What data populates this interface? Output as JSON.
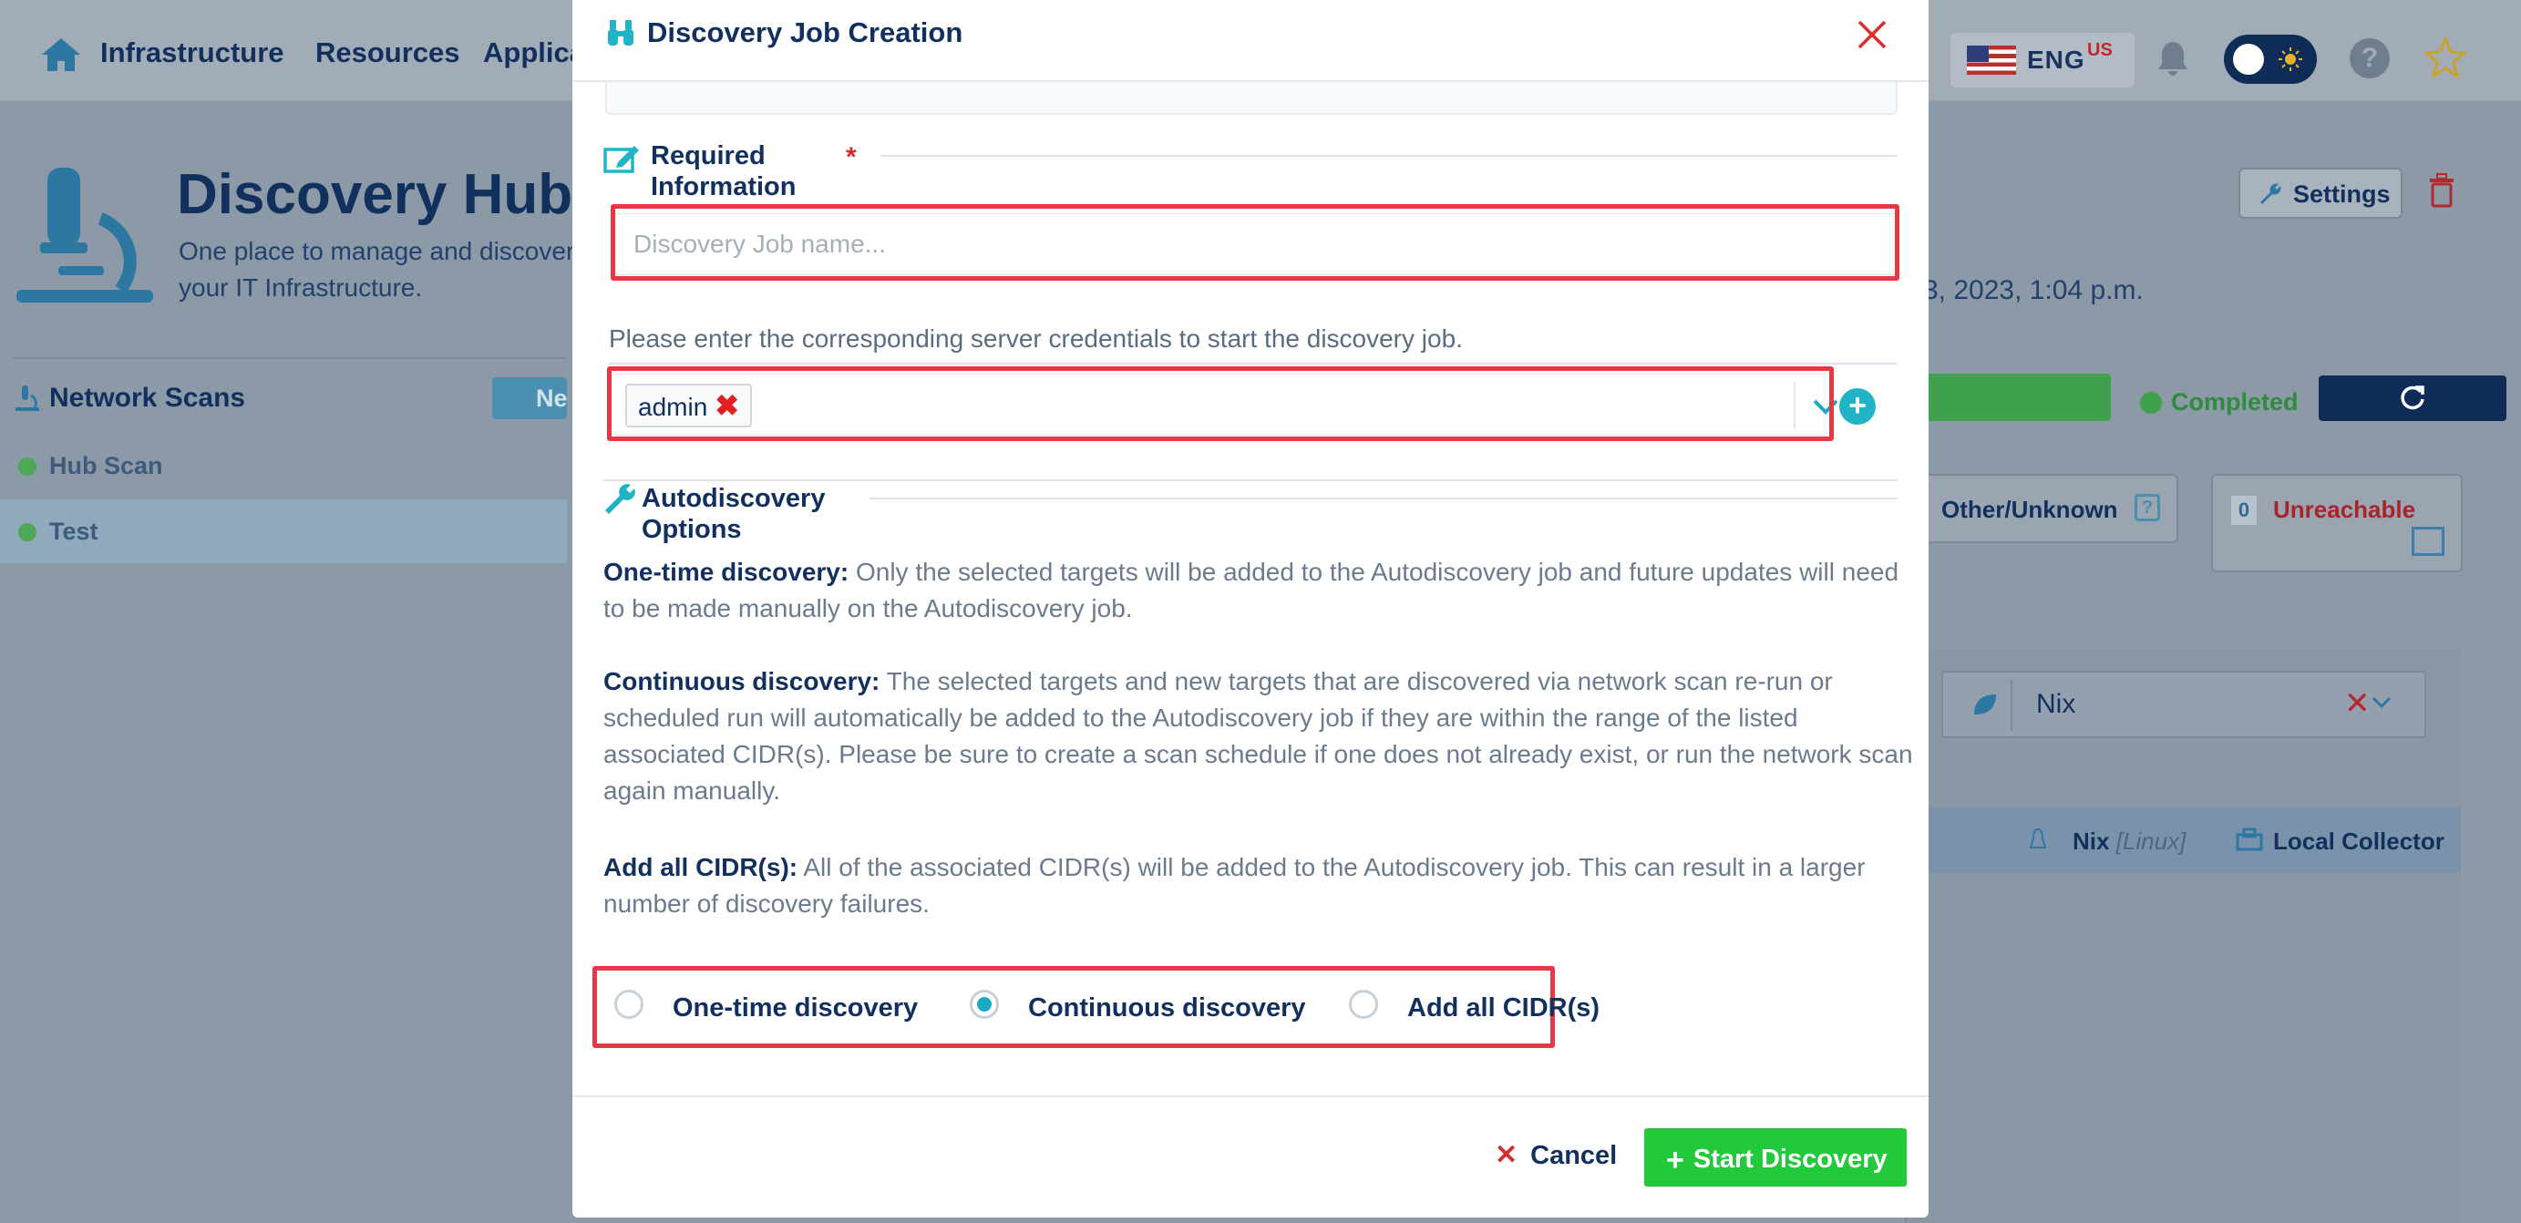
{
  "topnav": {
    "items": [
      "Infrastructure",
      "Resources",
      "Applica"
    ],
    "language": "ENG",
    "region": "US"
  },
  "hub": {
    "title": "Discovery Hub",
    "subtitle": "One place to manage and discover your IT Infrastructure.",
    "settings_label": "Settings",
    "last_run": "3, 2023, 1:04 p.m.",
    "network_scans_label": "Network Scans",
    "new_button_label": "Ne",
    "scans": [
      "Hub Scan",
      "Test"
    ],
    "status": "Completed",
    "other_unknown_label": "Other/Unknown",
    "unreachable_count": "0",
    "unreachable_label": "Unreachable",
    "filter_value": "Nix",
    "row": {
      "os": "Nix",
      "os_family": "[Linux]",
      "collector": "Local Collector"
    }
  },
  "modal": {
    "title": "Discovery Job Creation",
    "required_section": "Required Information",
    "required_marker": "*",
    "job_name": {
      "value": "",
      "placeholder": "Discovery Job name..."
    },
    "credentials_prompt": "Please enter the corresponding server credentials to start the discovery job.",
    "selected_credentials": [
      "admin"
    ],
    "autodiscovery_section": "Autodiscovery Options",
    "descriptions": [
      {
        "term": "One-time discovery:",
        "text": "Only the selected targets will be added to the Autodiscovery job and future updates will need to be made manually on the Autodiscovery job."
      },
      {
        "term": "Continuous discovery:",
        "text": "The selected targets and new targets that are discovered via network scan re-run or scheduled run will automatically be added to the Autodiscovery job if they are within the range of the listed associated CIDR(s). Please be sure to create a scan schedule if one does not already exist, or run the network scan again manually."
      },
      {
        "term": "Add all CIDR(s):",
        "text": "All of the associated CIDR(s) will be added to the Autodiscovery job. This can result in a larger number of discovery failures."
      }
    ],
    "options": [
      {
        "label": "One-time discovery",
        "selected": false
      },
      {
        "label": "Continuous discovery",
        "selected": true
      },
      {
        "label": "Add all CIDR(s)",
        "selected": false
      }
    ],
    "cancel_label": "Cancel",
    "start_label": "Start Discovery"
  },
  "colors": {
    "primary_navy": "#12305e",
    "accent_teal": "#1aaabf",
    "start_green": "#22c93a",
    "highlight_red": "#e63946",
    "overlay": "#8c99a6"
  }
}
